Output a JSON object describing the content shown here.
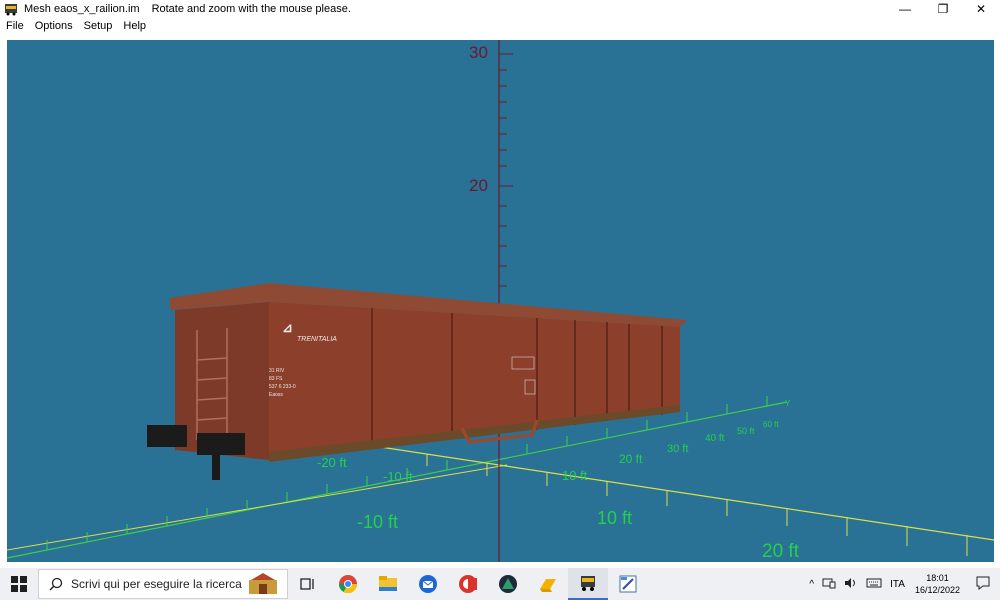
{
  "window": {
    "title": "Mesh eaos_x_railion.im",
    "hint": "Rotate and zoom with the mouse please.",
    "controls": {
      "minimize": "—",
      "restore": "❐",
      "close": "✕"
    }
  },
  "menu": [
    "File",
    "Options",
    "Setup",
    "Help"
  ],
  "viewport": {
    "background": "#2a7196",
    "axis_color": "#6b1a2a",
    "grid_color": "#d8e04a",
    "label_color": "#25d04a",
    "vertical_ticks": [
      "30",
      "20"
    ],
    "grid_labels_left": [
      "-20 ft",
      "-10 ft",
      "-10 ft"
    ],
    "grid_labels_right": [
      "10 ft",
      "20 ft",
      "30 ft",
      "40 ft",
      "50 ft",
      "60 ft",
      "10 ft",
      "20 ft"
    ],
    "near_labels": [
      "-10 ft",
      "10 ft",
      "20 ft"
    ],
    "axis_y_label": "Y",
    "wagon": {
      "brand": "TRENITALIA",
      "code_lines": [
        "31 RIV",
        "83 FS",
        "537 6 233-0",
        "Eaoss"
      ]
    }
  },
  "taskbar": {
    "search_placeholder": "Scrivi qui per eseguire la ricerca",
    "apps": [
      "task-view",
      "chrome",
      "file-explorer",
      "thunderbird",
      "app-red",
      "app-dark",
      "app-yellow",
      "app-train",
      "app-paint"
    ],
    "tray": {
      "language": "ITA",
      "time": "18:01",
      "date": "16/12/2022"
    }
  }
}
